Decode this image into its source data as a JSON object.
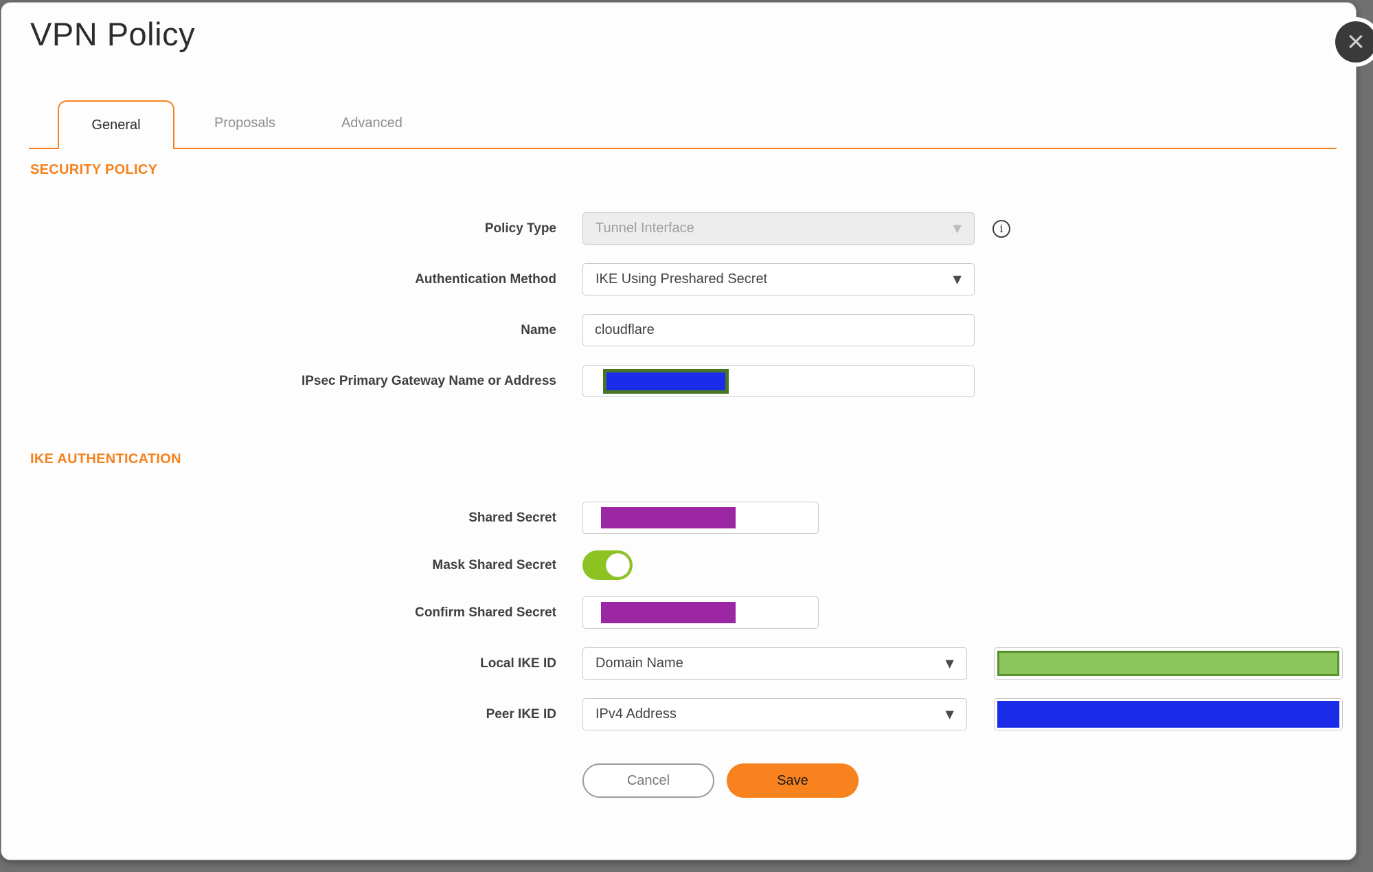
{
  "colors": {
    "backdrop": "#707070",
    "orange": "#F6821D",
    "orange_btn": "#F8821D",
    "purple": "#9B27A4",
    "blue": "#1B2CE9",
    "olive": "#4A7426",
    "green_fill": "#8DC65C",
    "green_border": "#57922E",
    "toggle_green": "#8CC222"
  },
  "icons": {
    "chevron_down": "▼",
    "info": "i",
    "close": "×"
  },
  "dialog": {
    "title": "VPN Policy"
  },
  "tabs": [
    {
      "label": "General",
      "active": true
    },
    {
      "label": "Proposals",
      "active": false
    },
    {
      "label": "Advanced",
      "active": false
    }
  ],
  "security_policy": {
    "heading": "SECURITY POLICY",
    "policy_type": {
      "label": "Policy Type",
      "value": "Tunnel Interface",
      "disabled": true
    },
    "auth_method": {
      "label": "Authentication Method",
      "value": "IKE Using Preshared Secret"
    },
    "name": {
      "label": "Name",
      "value": "cloudflare"
    },
    "gateway": {
      "label": "IPsec Primary Gateway Name or Address",
      "value_masked": true
    }
  },
  "ike_authentication": {
    "heading": "IKE AUTHENTICATION",
    "shared_secret": {
      "label": "Shared Secret",
      "value_masked": true
    },
    "mask_shared_secret": {
      "label": "Mask Shared Secret",
      "toggle_on": true
    },
    "confirm_shared_secret": {
      "label": "Confirm Shared Secret",
      "value_masked": true
    },
    "local_ike_id": {
      "label": "Local IKE ID",
      "value": "Domain Name",
      "id_value_masked": true
    },
    "peer_ike_id": {
      "label": "Peer IKE ID",
      "value": "IPv4 Address",
      "id_value_masked": true
    }
  },
  "buttons": {
    "cancel": {
      "label": "Cancel"
    },
    "save": {
      "label": "Save"
    }
  }
}
